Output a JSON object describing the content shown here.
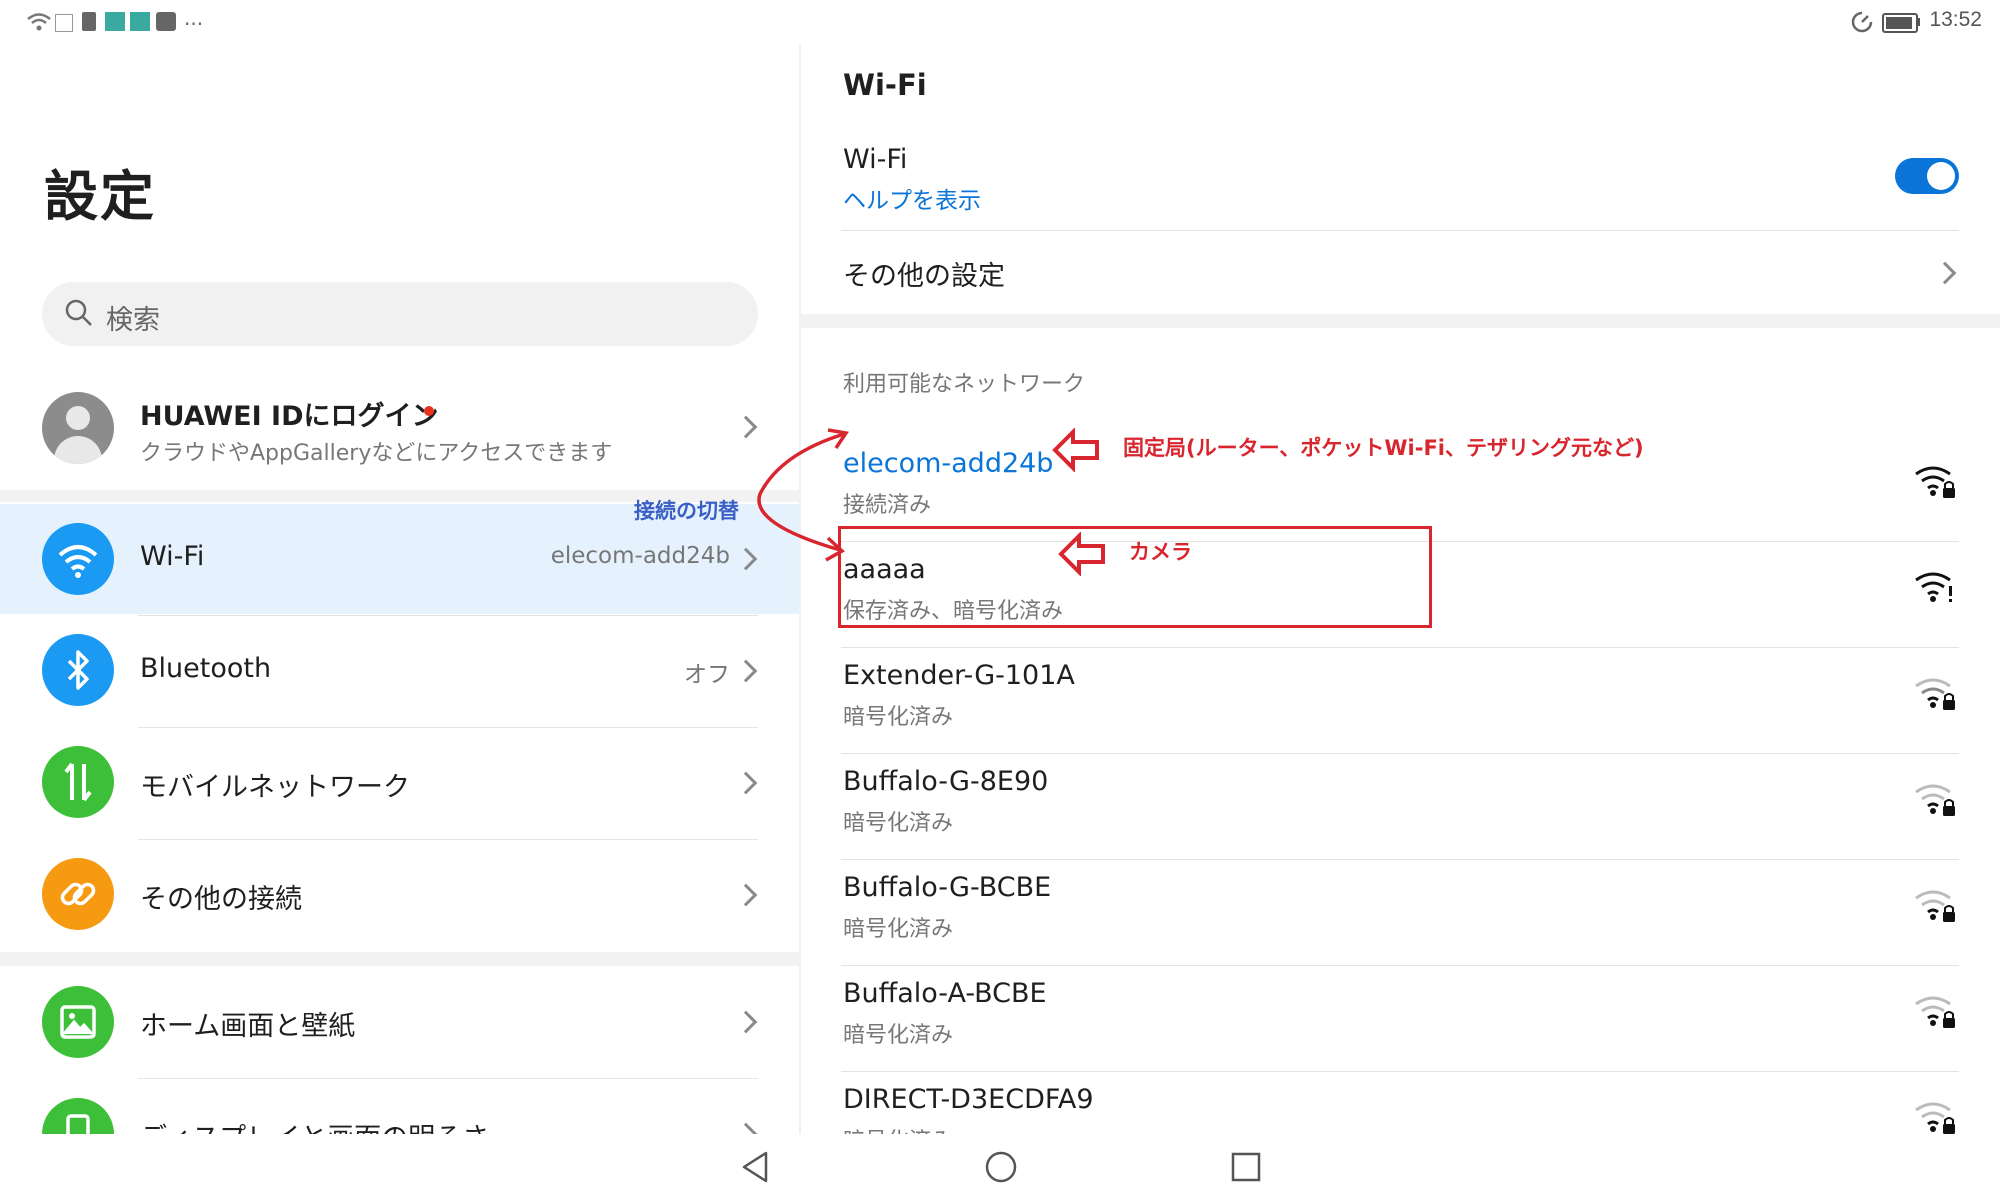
{
  "status_bar": {
    "time": "13:52",
    "icons": [
      "wifi-icon",
      "nfc-icon",
      "sim-icon",
      "android-icon",
      "android-icon",
      "huawei-icon",
      "more-icon",
      "sync-icon",
      "battery-icon"
    ],
    "more": "..."
  },
  "left": {
    "title": "設定",
    "search": {
      "placeholder": "検索"
    },
    "account": {
      "title": "HUAWEI IDにログイン",
      "subtitle": "クラウドやAppGalleryなどにアクセスできます"
    },
    "items": [
      {
        "label": "Wi-Fi",
        "value": "elecom-add24b",
        "icon": "wifi-icon",
        "color": "#1a9af2",
        "selected": true
      },
      {
        "label": "Bluetooth",
        "value": "オフ",
        "icon": "bluetooth-icon",
        "color": "#1a9af2"
      },
      {
        "label": "モバイルネットワーク",
        "value": "",
        "icon": "mobile-data-icon",
        "color": "#3dbf3a"
      },
      {
        "label": "その他の接続",
        "value": "",
        "icon": "link-icon",
        "color": "#f59a11"
      },
      {
        "label": "ホーム画面と壁紙",
        "value": "",
        "icon": "image-icon",
        "color": "#3dbf3a"
      },
      {
        "label": "ディスプレイと画面の明るさ",
        "value": "",
        "icon": "display-icon",
        "color": "#3dbf3a"
      }
    ]
  },
  "right": {
    "title": "Wi-Fi",
    "wifi_toggle": {
      "label": "Wi-Fi",
      "help": "ヘルプを表示",
      "on": true
    },
    "other_settings": "その他の設定",
    "section_label": "利用可能なネットワーク",
    "networks": [
      {
        "name": "elecom-add24b",
        "status": "接続済み",
        "connected": true
      },
      {
        "name": "aaaaa",
        "status": "保存済み、暗号化済み"
      },
      {
        "name": "Extender-G-101A",
        "status": "暗号化済み"
      },
      {
        "name": "Buffalo-G-8E90",
        "status": "暗号化済み"
      },
      {
        "name": "Buffalo-G-BCBE",
        "status": "暗号化済み"
      },
      {
        "name": "Buffalo-A-BCBE",
        "status": "暗号化済み"
      },
      {
        "name": "DIRECT-D3ECDFA9",
        "status": "暗号化済み"
      }
    ]
  },
  "annotations": {
    "fixed_station": "固定局(ルーター、ポケットWi-Fi、テザリング元など)",
    "camera": "カメラ",
    "switch": "接続の切替"
  },
  "colors": {
    "accent": "#0a74d9",
    "annotation_red": "#d9262e",
    "annotation_blue": "#3b5fc4",
    "selected_bg": "#e5f2fd"
  }
}
